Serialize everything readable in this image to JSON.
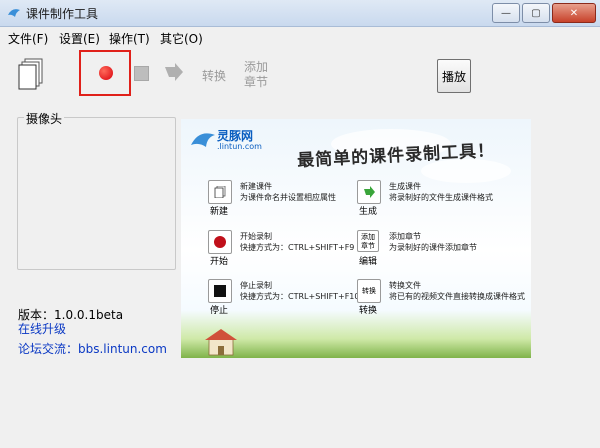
{
  "window": {
    "title": "课件制作工具",
    "minimize": "—",
    "maximize": "▢",
    "close": "✕"
  },
  "menu": [
    {
      "label": "文件(F)"
    },
    {
      "label": "设置(E)"
    },
    {
      "label": "操作(T)"
    },
    {
      "label": "其它(O)"
    }
  ],
  "toolbar": {
    "convert_label": "转换",
    "add_chapter_label_1": "添加",
    "add_chapter_label_2": "章节",
    "play_label": "播放"
  },
  "camera": {
    "legend": "摄像头"
  },
  "info": {
    "version": "版本：1.0.0.1beta",
    "upgrade": "在线升级",
    "forum": "论坛交流：bbs.lintun.com"
  },
  "banner": {
    "brand": "灵豚网",
    "url": ".lintun.com",
    "slogan": "最简单的课件录制工具！",
    "features": [
      {
        "key": "new",
        "icon_label": "新建",
        "line1": "新建课件",
        "line2": "为课件命名并设置相应属性"
      },
      {
        "key": "start",
        "icon_label": "开始",
        "line1": "开始录制",
        "line2": "快捷方式为：CTRL+SHIFT+F9"
      },
      {
        "key": "stop",
        "icon_label": "停止",
        "line1": "停止录制",
        "line2": "快捷方式为：CTRL+SHIFT+F10"
      },
      {
        "key": "generate",
        "icon_label": "生成",
        "line1": "生成课件",
        "line2": "将录制好的文件生成课件格式"
      },
      {
        "key": "edit",
        "icon_label": "编辑",
        "box_text": "添加章节",
        "line1": "添加章节",
        "line2": "为录制好的课件添加章节"
      },
      {
        "key": "convert",
        "icon_label": "转换",
        "box_text": "转换",
        "line1": "转换文件",
        "line2": "将已有的视频文件直接转换成课件格式"
      }
    ]
  },
  "colors": {
    "accent_red": "#e0201a",
    "link_blue": "#0b39c4"
  }
}
